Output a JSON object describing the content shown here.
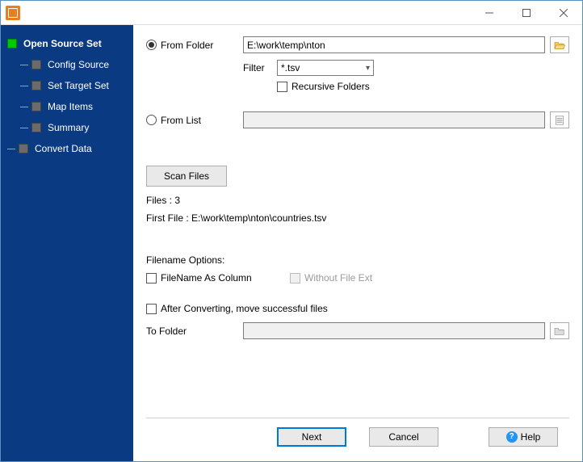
{
  "titlebar": {
    "title": ""
  },
  "sidebar": {
    "items": [
      {
        "label": "Open Source Set",
        "active": true
      },
      {
        "label": "Config Source"
      },
      {
        "label": "Set Target Set"
      },
      {
        "label": "Map Items"
      },
      {
        "label": "Summary"
      },
      {
        "label": "Convert Data"
      }
    ]
  },
  "source": {
    "from_folder_label": "From Folder",
    "folder_path": "E:\\work\\temp\\nton",
    "filter_label": "Filter",
    "filter_value": "*.tsv",
    "recursive_label": "Recursive Folders",
    "from_list_label": "From List",
    "list_path": ""
  },
  "scan": {
    "button": "Scan Files",
    "files_label": "Files : 3",
    "first_file_label": "First File : E:\\work\\temp\\nton\\countries.tsv"
  },
  "filename_options": {
    "heading": "Filename Options:",
    "as_column_label": "FileName As Column",
    "without_ext_label": "Without File Ext"
  },
  "after": {
    "move_label": "After Converting, move successful files",
    "to_folder_label": "To Folder",
    "to_folder_path": ""
  },
  "footer": {
    "next": "Next",
    "cancel": "Cancel",
    "help": "Help"
  }
}
